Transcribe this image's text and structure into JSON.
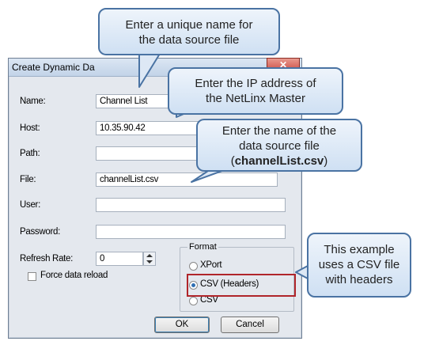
{
  "dialog": {
    "title": "Create Dynamic Da",
    "close_glyph": "✕",
    "fields": {
      "name": {
        "label": "Name:",
        "value": "Channel List"
      },
      "host": {
        "label": "Host:",
        "value": "10.35.90.42"
      },
      "path": {
        "label": "Path:",
        "value": ""
      },
      "file": {
        "label": "File:",
        "value": "channelList.csv"
      },
      "user": {
        "label": "User:",
        "value": ""
      },
      "password": {
        "label": "Password:",
        "value": ""
      },
      "refresh": {
        "label": "Refresh Rate:",
        "value": "0"
      }
    },
    "force_reload_label": "Force data reload",
    "force_reload_checked": false,
    "format": {
      "legend": "Format",
      "options": [
        "XPort",
        "CSV (Headers)",
        "CSV"
      ],
      "selected": "CSV (Headers)"
    },
    "ok_label": "OK",
    "cancel_label": "Cancel"
  },
  "callouts": {
    "name": [
      "Enter a unique name for",
      "the data source file"
    ],
    "ip": [
      "Enter the IP address of",
      "the NetLinx Master"
    ],
    "file": [
      "Enter the name of the",
      "data source file"
    ],
    "file_bold": "channelList.csv",
    "csv": [
      "This example",
      "uses a CSV file",
      "with headers"
    ]
  },
  "colors": {
    "highlight": "#b0252a",
    "callout_border": "#4a73a3"
  }
}
